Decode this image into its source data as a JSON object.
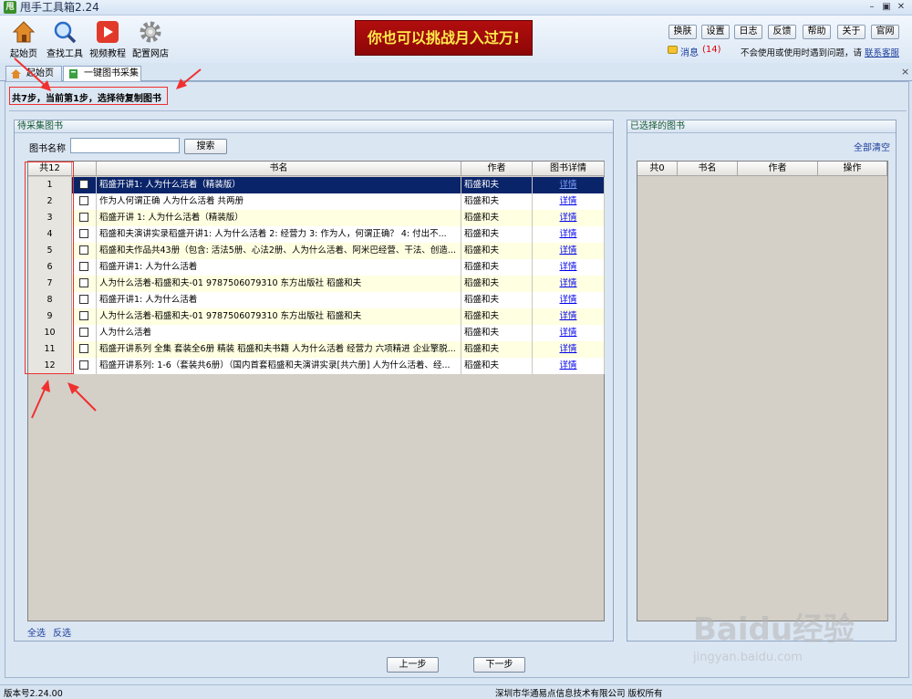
{
  "app": {
    "title": "甩手工具箱2.24",
    "icon_text": "甩"
  },
  "toolbar": {
    "items": [
      {
        "label": "起始页",
        "icon": "home-icon"
      },
      {
        "label": "查找工具",
        "icon": "search-icon"
      },
      {
        "label": "视频教程",
        "icon": "video-icon"
      },
      {
        "label": "配置网店",
        "icon": "gear-icon"
      }
    ]
  },
  "banner": {
    "text": "你也可以挑战月入过万!"
  },
  "top_buttons": [
    "换肤",
    "设置",
    "日志",
    "反馈",
    "帮助",
    "关于",
    "官网"
  ],
  "message": {
    "label": "消息",
    "count": "(14)"
  },
  "help": {
    "text": "不会使用或使用时遇到问题，请",
    "link": "联系客服"
  },
  "tabs": [
    {
      "label": "起始页"
    },
    {
      "label": "一键图书采集"
    }
  ],
  "step": {
    "text": "共7步，当前第1步，选择待复制图书"
  },
  "left_panel": {
    "title": "待采集图书",
    "search_label": "图书名称",
    "search_value": "",
    "search_button": "搜索",
    "headers": {
      "count": "共12",
      "title": "书名",
      "author": "作者",
      "detail": "图书详情"
    },
    "rows": [
      {
        "n": "1",
        "title": "稻盛开讲1: 人为什么活着（精装版）",
        "author": "稻盛和夫",
        "detail": "详情"
      },
      {
        "n": "2",
        "title": "作为人何谓正确 人为什么活着 共两册",
        "author": "稻盛和夫",
        "detail": "详情"
      },
      {
        "n": "3",
        "title": "稻盛开讲 1: 人为什么活着（精装版）",
        "author": "稻盛和夫",
        "detail": "详情"
      },
      {
        "n": "4",
        "title": "稻盛和夫演讲实录稻盛开讲1: 人为什么活着 2: 经营力 3: 作为人，何谓正确？ 4: 付出不...",
        "author": "稻盛和夫",
        "detail": "详情"
      },
      {
        "n": "5",
        "title": "稻盛和夫作品共43册（包含: 活法5册、心法2册、人为什么活着、阿米巴经营、干法、创造...",
        "author": "稻盛和夫",
        "detail": "详情"
      },
      {
        "n": "6",
        "title": "稻盛开讲1: 人为什么活着",
        "author": "稻盛和夫",
        "detail": "详情"
      },
      {
        "n": "7",
        "title": "人为什么活着-稻盛和夫-01  9787506079310 东方出版社 稻盛和夫",
        "author": "稻盛和夫",
        "detail": "详情"
      },
      {
        "n": "8",
        "title": "稻盛开讲1: 人为什么活着",
        "author": "稻盛和夫",
        "detail": "详情"
      },
      {
        "n": "9",
        "title": "人为什么活着-稻盛和夫-01 9787506079310 东方出版社 稻盛和夫",
        "author": "稻盛和夫",
        "detail": "详情"
      },
      {
        "n": "10",
        "title": "人为什么活着",
        "author": "稻盛和夫",
        "detail": "详情"
      },
      {
        "n": "11",
        "title": "稻盛开讲系列 全集 套装全6册 精装 稻盛和夫书籍 人为什么活着 经营力 六项精进 企业擎脱...",
        "author": "稻盛和夫",
        "detail": "详情"
      },
      {
        "n": "12",
        "title": "稻盛开讲系列: 1-6（套装共6册）（国内首套稻盛和夫演讲实录[共六册] 人为什么活着、经...",
        "author": "稻盛和夫",
        "detail": "详情"
      }
    ],
    "select_all": "全选",
    "invert": "反选"
  },
  "right_panel": {
    "title": "已选择的图书",
    "clear_all": "全部清空",
    "headers": {
      "count": "共0",
      "title": "书名",
      "author": "作者",
      "action": "操作"
    }
  },
  "nav": {
    "prev": "上一步",
    "next": "下一步"
  },
  "status": {
    "version": "版本号2.24.00",
    "company": "深圳市华通易点信息技术有限公司 版权所有"
  },
  "watermark": {
    "text": "Baidu经验",
    "sub": "jingyan.baidu.com"
  }
}
